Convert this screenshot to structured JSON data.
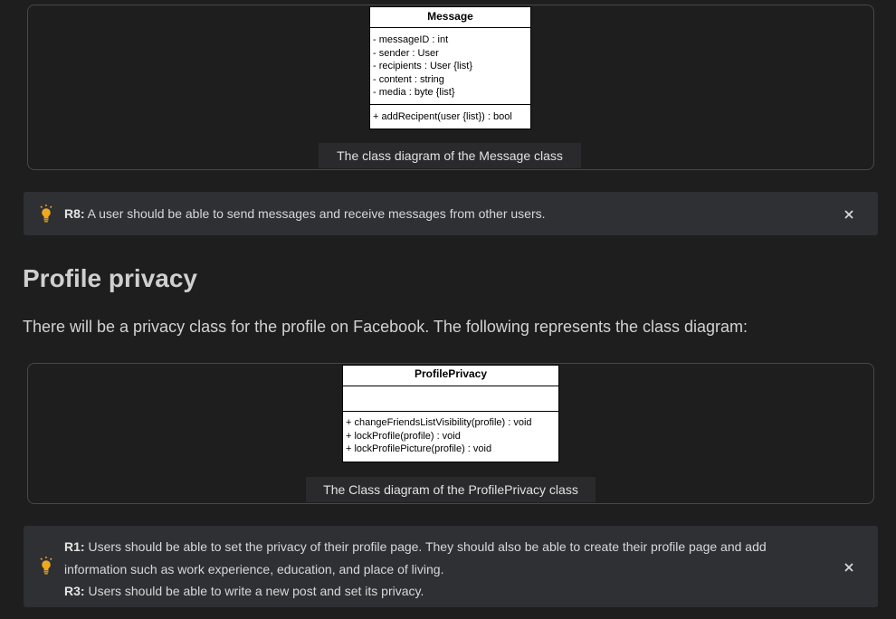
{
  "message_figure": {
    "class_name": "Message",
    "attributes": [
      "- messageID : int",
      "- sender : User",
      "- recipients : User {list}",
      "- content : string",
      "- media : byte {list}"
    ],
    "methods": [
      "+ addRecipent(user {list}) : bool"
    ],
    "caption": "The class diagram of the Message class"
  },
  "callout_r8": {
    "label": "R8:",
    "text": " A user should be able to send messages and receive messages from other users."
  },
  "section": {
    "heading": "Profile privacy",
    "paragraph": "There will be a privacy class for the profile on Facebook. The following represents the class diagram:"
  },
  "privacy_figure": {
    "class_name": "ProfilePrivacy",
    "methods": [
      "+ changeFriendsListVisibility(profile) : void",
      "+ lockProfile(profile) : void",
      "+ lockProfilePicture(profile) : void"
    ],
    "caption": "The Class diagram of the ProfilePrivacy class"
  },
  "callout_r1_r3": {
    "r1_label": "R1:",
    "r1_text_line1": " Users should be able to set the privacy of their profile page. They should also be able to create their profile page and add",
    "r1_text_line2": "information such as work experience, education, and place of living.",
    "r3_label": "R3:",
    "r3_text": " Users should be able to write a new post and set its privacy."
  },
  "colors": {
    "background": "#1e1e1f",
    "callout_bg": "#2e3034",
    "bulb": "#f0a81e"
  },
  "icons": {
    "bulb": "lightbulb-icon",
    "close": "close-icon"
  }
}
